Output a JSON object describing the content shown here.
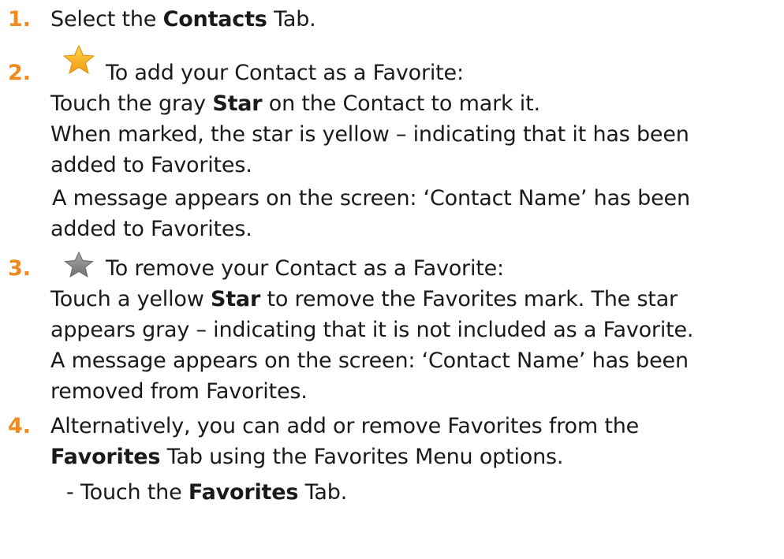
{
  "steps": [
    {
      "number": "1.",
      "lines": [
        {
          "pre": "Select the ",
          "bold": "Contacts",
          "post": " Tab."
        }
      ]
    },
    {
      "number": "2.",
      "icon": "yellow-star-icon",
      "icon_color": "#f7b21f",
      "lines": [
        {
          "pre": "To add your Contact as a Favorite:"
        },
        {
          "pre": "Touch the gray ",
          "bold": "Star",
          "post": " on the Contact to mark it."
        },
        {
          "pre": "When marked, the star is yellow – indicating that it has been"
        },
        {
          "pre": "added to Favorites."
        },
        {
          "pre": " A message appears on the screen: ‘Contact Name’ has been"
        },
        {
          "pre": "added to Favorites."
        }
      ]
    },
    {
      "number": "3.",
      "icon": "gray-star-icon",
      "icon_color": "#8c8c8c",
      "lines": [
        {
          "pre": "To remove your Contact as a Favorite:"
        },
        {
          "pre": "Touch a yellow ",
          "bold": "Star",
          "post": " to remove the Favorites mark. The star"
        },
        {
          "pre": "appears gray – indicating that it is not included as a Favorite."
        },
        {
          "pre": "A message appears on the screen: ‘Contact Name’ has been"
        },
        {
          "pre": "removed from Favorites."
        }
      ]
    },
    {
      "number": "4.",
      "lines": [
        {
          "pre": "Alternatively, you can add or remove Favorites from the"
        },
        {
          "pre": "",
          "bold": "Favorites",
          "post": " Tab using the Favorites Menu options."
        },
        {
          "pre": "-  Touch the ",
          "bold": "Favorites",
          "post": " Tab."
        }
      ]
    }
  ],
  "colors": {
    "number": "#f08a1c",
    "text": "#1a1a1a"
  }
}
